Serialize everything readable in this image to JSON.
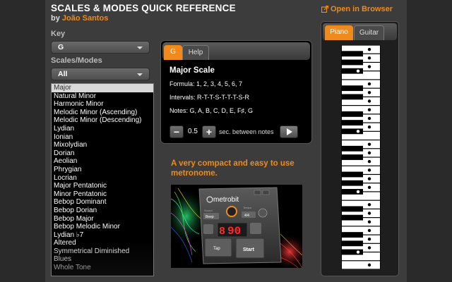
{
  "header": {
    "title": "SCALES & MODES QUICK REFERENCE",
    "by_label": "by",
    "author": "João Santos",
    "open_in_browser": "Open in Browser",
    "open_icon": "external-link-icon"
  },
  "key": {
    "label": "Key",
    "selected": "G"
  },
  "scales_modes": {
    "label": "Scales/Modes",
    "selected": "All"
  },
  "scale_list": {
    "items": [
      "Major",
      "Natural Minor",
      "Harmonic Minor",
      "Melodic Minor (Ascending)",
      "Melodic Minor (Descending)",
      "Lydian",
      "Ionian",
      "Mixolydian",
      "Dorian",
      "Aeolian",
      "Phrygian",
      "Locrian",
      "Major Pentatonic",
      "Minor Pentatonic",
      "Bebop Dominant",
      "Bebop Dorian",
      "Bebop Major",
      "Bebop Melodic Minor",
      "Lydian ♭7",
      "Altered",
      "Symmetrical Diminished",
      "Blues",
      "Whole Tone"
    ],
    "selected_index": 0
  },
  "info_panel": {
    "tabs": [
      "G",
      "Help"
    ],
    "active_tab": "G",
    "scale_name": "Major Scale",
    "formula": "Formula: 1, 2, 3, 4, 5, 6, 7",
    "intervals": "Intervals: R-T-T-S-T-T-T-S-R",
    "notes": "Notes: G, A, B, C, D, E, F♯, G"
  },
  "playback": {
    "minus": "−",
    "plus": "+",
    "value": "0.5",
    "unit_label": "sec. between notes"
  },
  "promo": {
    "text": "A very compact and easy to use metronome.",
    "app_name": "metrobit",
    "bpm": "90",
    "tempo_label": "Tempo",
    "sound_label": "Sound",
    "beep": "Beep",
    "time_sig": "4/4",
    "tap_label": "Tap",
    "start_label": "Start"
  },
  "instrument_tabs": {
    "tabs": [
      "Piano",
      "Guitar"
    ],
    "active_tab": "Piano"
  },
  "piano": {
    "white_key_count": 26,
    "highlighted_notes": [
      "G",
      "A",
      "B",
      "C",
      "D",
      "E",
      "F♯"
    ]
  },
  "colors": {
    "accent": "#f08a1c",
    "background": "#3c3c3c",
    "panel": "#000000"
  }
}
